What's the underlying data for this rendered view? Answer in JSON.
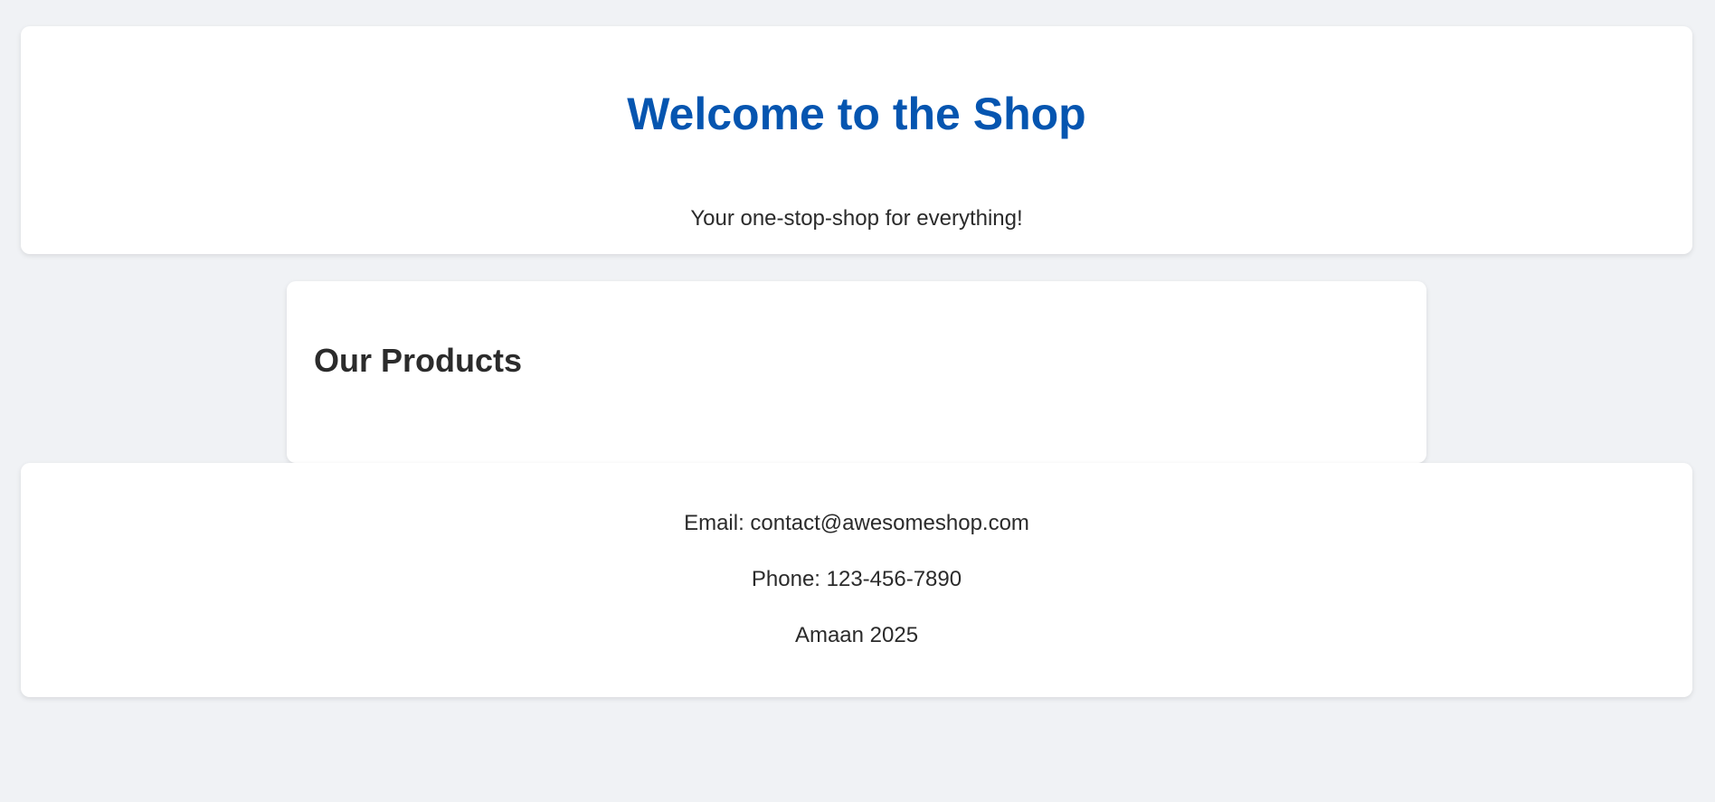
{
  "header": {
    "title": "Welcome to the Shop",
    "subtitle": "Your one-stop-shop for everything!",
    "title_color": "#0555b0"
  },
  "products": {
    "heading": "Our Products"
  },
  "footer": {
    "email": "Email: contact@awesomeshop.com",
    "phone": "Phone: 123-456-7890",
    "credit": "Amaan 2025"
  }
}
